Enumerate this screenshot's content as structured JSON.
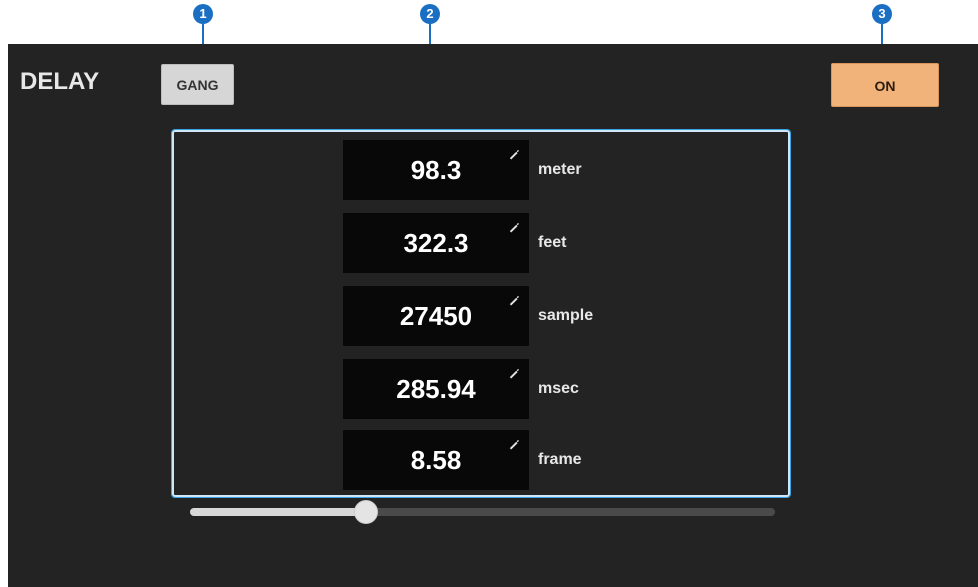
{
  "callouts": [
    "1",
    "2",
    "3"
  ],
  "panel": {
    "title": "DELAY",
    "gang_label": "GANG",
    "on_label": "ON"
  },
  "delay_values": [
    {
      "value": "98.3",
      "unit": "meter"
    },
    {
      "value": "322.3",
      "unit": "feet"
    },
    {
      "value": "27450",
      "unit": "sample"
    },
    {
      "value": "285.94",
      "unit": "msec"
    },
    {
      "value": "8.58",
      "unit": "frame"
    }
  ],
  "slider": {
    "position_fraction": 0.3
  },
  "icons": {
    "edit": "pencil-icon"
  },
  "colors": {
    "panel_bg": "#232323",
    "value_bg": "#080808",
    "on_button": "#f2b37a",
    "gang_button": "#d6d6d6",
    "callout": "#1a6fc2",
    "highlight": "#3aa3e6"
  }
}
